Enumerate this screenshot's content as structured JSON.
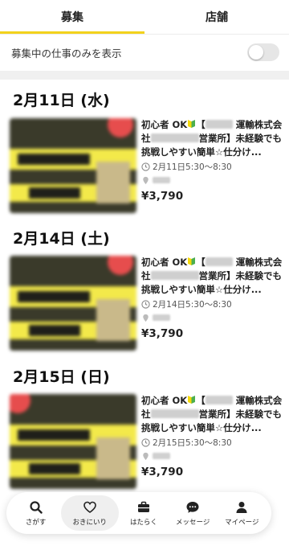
{
  "tabs": [
    {
      "label": "募集",
      "active": true
    },
    {
      "label": "店舗",
      "active": false
    }
  ],
  "filter": {
    "label": "募集中の仕事のみを表示",
    "enabled": false
  },
  "sections": [
    {
      "date": "2月11日 (水)",
      "job": {
        "title_prefix": "初心者 OK",
        "title_a": "【",
        "title_b": " 運輸株式会社",
        "title_c": "営業所】未経験でも挑戦しやすい簡単☆仕分け...",
        "schedule": "2月11日5:30～8:30",
        "price": "¥3,790"
      }
    },
    {
      "date": "2月14日 (土)",
      "job": {
        "title_prefix": "初心者 OK",
        "title_a": "【",
        "title_b": " 運輸株式会社",
        "title_c": "営業所】未経験でも挑戦しやすい簡単☆仕分け...",
        "schedule": "2月14日5:30～8:30",
        "price": "¥3,790"
      }
    },
    {
      "date": "2月15日 (日)",
      "job": {
        "title_prefix": "初心者 OK",
        "title_a": "【",
        "title_b": " 運輸株式会社",
        "title_c": "営業所】未経験でも挑戦しやすい簡単☆仕分け...",
        "schedule": "2月15日5:30～8:30",
        "price": "¥3,790"
      }
    }
  ],
  "bottom_nav": [
    {
      "label": "さがす",
      "icon": "search-icon",
      "active": false
    },
    {
      "label": "おきにいり",
      "icon": "heart-icon",
      "active": true
    },
    {
      "label": "はたらく",
      "icon": "briefcase-icon",
      "active": false
    },
    {
      "label": "メッセージ",
      "icon": "chat-icon",
      "active": false
    },
    {
      "label": "マイページ",
      "icon": "person-icon",
      "active": false
    }
  ],
  "colors": {
    "accent": "#f2d21c",
    "beginner_green": "#4caf50",
    "beginner_yellow": "#f5d90a"
  }
}
